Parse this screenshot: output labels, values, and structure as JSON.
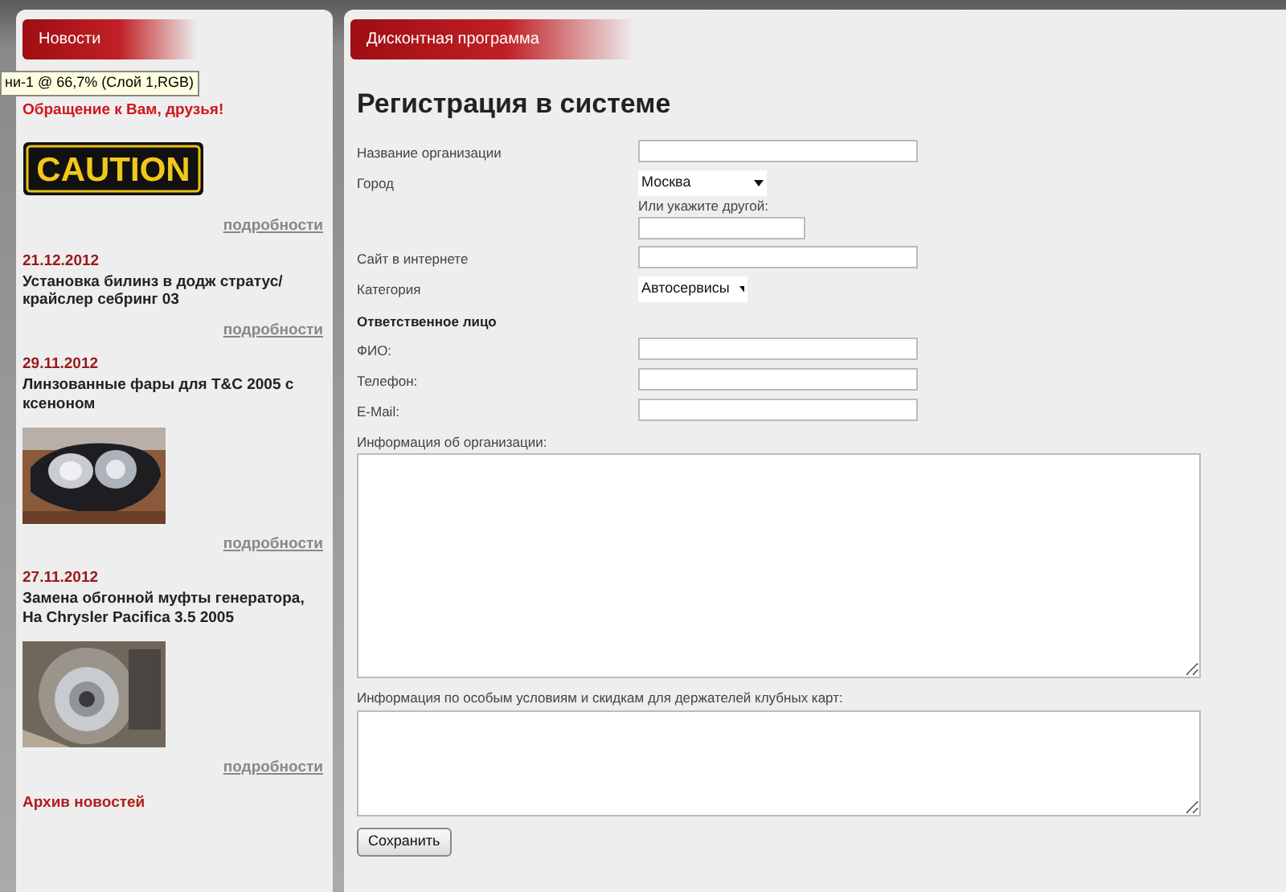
{
  "tooltip": "ни-1 @ 66,7% (Слой 1,RGB)",
  "news_panel": {
    "title": "Новости",
    "items": [
      {
        "kind": "sign",
        "title": "Обращение к Вам, друзья!",
        "sign_text": "CAUTION",
        "more": "подробности"
      },
      {
        "kind": "text",
        "date": "21.12.2012",
        "title": "Установка билинз в додж стратус/ крайслер себринг 03",
        "more": "подробности"
      },
      {
        "date": "29.11.2012",
        "title": "Линзованные фары для T&C 2005 с ксеноном",
        "more": "подробности"
      },
      {
        "date": "27.11.2012",
        "title": "Замена обгонной муфты генератора, На Chrysler Pacifica 3.5 2005",
        "more": "подробности"
      }
    ],
    "archive": "Архив новостей"
  },
  "form_panel": {
    "title": "Дисконтная программа",
    "heading": "Регистрация в системе",
    "fields": [
      {
        "kind": "input",
        "label": "Название организации"
      },
      {
        "kind": "city",
        "label": "Город",
        "value": "Москва",
        "other_label": "Или укажите другой:"
      },
      {
        "kind": "input",
        "label": "Сайт в интернете"
      },
      {
        "kind": "select",
        "label": "Категория",
        "value": "Автосервисы"
      },
      {
        "kind": "section",
        "label": "Ответственное лицо"
      },
      {
        "kind": "input",
        "label": "ФИО:"
      },
      {
        "kind": "input",
        "label": "Телефон:"
      },
      {
        "kind": "input",
        "label": "E-Mail:"
      },
      {
        "kind": "textarea",
        "label": "Информация об организации:"
      },
      {
        "kind": "memo",
        "label": "Информация по особым условиям и скидкам для держателей клубных карт:"
      }
    ],
    "submit": "Сохранить"
  }
}
